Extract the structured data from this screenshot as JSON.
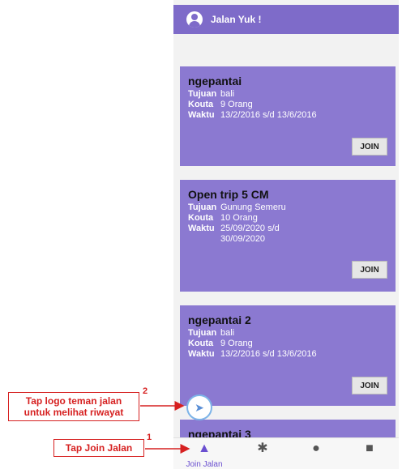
{
  "app": {
    "title": "Jalan Yuk !"
  },
  "labels": {
    "tujuan": "Tujuan",
    "kouta": "Kouta",
    "waktu": "Waktu",
    "join": "JOIN"
  },
  "trips": [
    {
      "name": "ngepantai",
      "tujuan": "bali",
      "kouta": "9 Orang",
      "waktu": "13/2/2016 s/d 13/6/2016"
    },
    {
      "name": "Open trip 5 CM",
      "tujuan": "Gunung Semeru",
      "kouta": "10 Orang",
      "waktu": "25/09/2020 s/d 30/09/2020"
    },
    {
      "name": "ngepantai 2",
      "tujuan": "bali",
      "kouta": "9 Orang",
      "waktu": "13/2/2016 s/d 13/6/2016"
    },
    {
      "name": "ngepantai 3"
    }
  ],
  "nav": {
    "join_label": "Join Jalan",
    "icons": [
      "join-jalan-icon",
      "walk-icon",
      "people-icon",
      "profile-icon"
    ]
  },
  "annotations": {
    "callout1": "Tap Join Jalan",
    "callout1_num": "1",
    "callout2_line1": "Tap logo teman jalan",
    "callout2_line2": "untuk melihat riwayat",
    "callout2_num": "2",
    "color": "#d62020"
  },
  "colors": {
    "primary": "#7e6bc9",
    "card": "#8b79d1"
  }
}
